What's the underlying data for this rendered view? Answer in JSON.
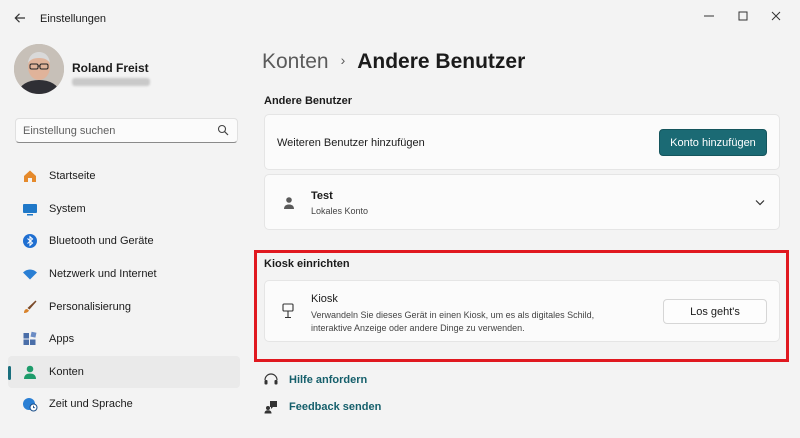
{
  "window": {
    "title": "Einstellungen",
    "back_icon": "arrow-left-icon",
    "controls": [
      "minimize-icon",
      "maximize-icon",
      "close-icon"
    ]
  },
  "profile": {
    "name": "Roland Freist"
  },
  "search": {
    "placeholder": "Einstellung suchen",
    "value": ""
  },
  "sidebar": {
    "items": [
      {
        "label": "Startseite",
        "icon": "home-icon",
        "color": "#e58a2c"
      },
      {
        "label": "System",
        "icon": "monitor-icon",
        "color": "#1f78c8"
      },
      {
        "label": "Bluetooth und Geräte",
        "icon": "bluetooth-icon",
        "color": "#1f6fd1"
      },
      {
        "label": "Netzwerk und Internet",
        "icon": "wifi-icon",
        "color": "#2a7fd4"
      },
      {
        "label": "Personalisierung",
        "icon": "brush-icon",
        "color": "#d8822a"
      },
      {
        "label": "Apps",
        "icon": "apps-icon",
        "color": "#4a6ea8"
      },
      {
        "label": "Konten",
        "icon": "person-icon",
        "color": "#1e9c6b"
      },
      {
        "label": "Zeit und Sprache",
        "icon": "globe-clock-icon",
        "color": "#2a7fd4"
      }
    ],
    "active_index": 6
  },
  "breadcrumb": {
    "parent": "Konten",
    "separator": "›",
    "current": "Andere Benutzer"
  },
  "other_users": {
    "section_title": "Andere Benutzer",
    "add_label": "Weiteren Benutzer hinzufügen",
    "add_button": "Konto hinzufügen",
    "user": {
      "name": "Test",
      "type": "Lokales Konto"
    }
  },
  "kiosk": {
    "section_title": "Kiosk einrichten",
    "title": "Kiosk",
    "description_line1": "Verwandeln Sie dieses Gerät in einen Kiosk, um es als digitales Schild,",
    "description_line2": "interaktive Anzeige oder andere Dinge zu verwenden.",
    "button": "Los geht's"
  },
  "links": {
    "help": "Hilfe anfordern",
    "feedback": "Feedback senden"
  },
  "colors": {
    "accent": "#1b6a74",
    "highlight_frame": "#e0181f"
  }
}
